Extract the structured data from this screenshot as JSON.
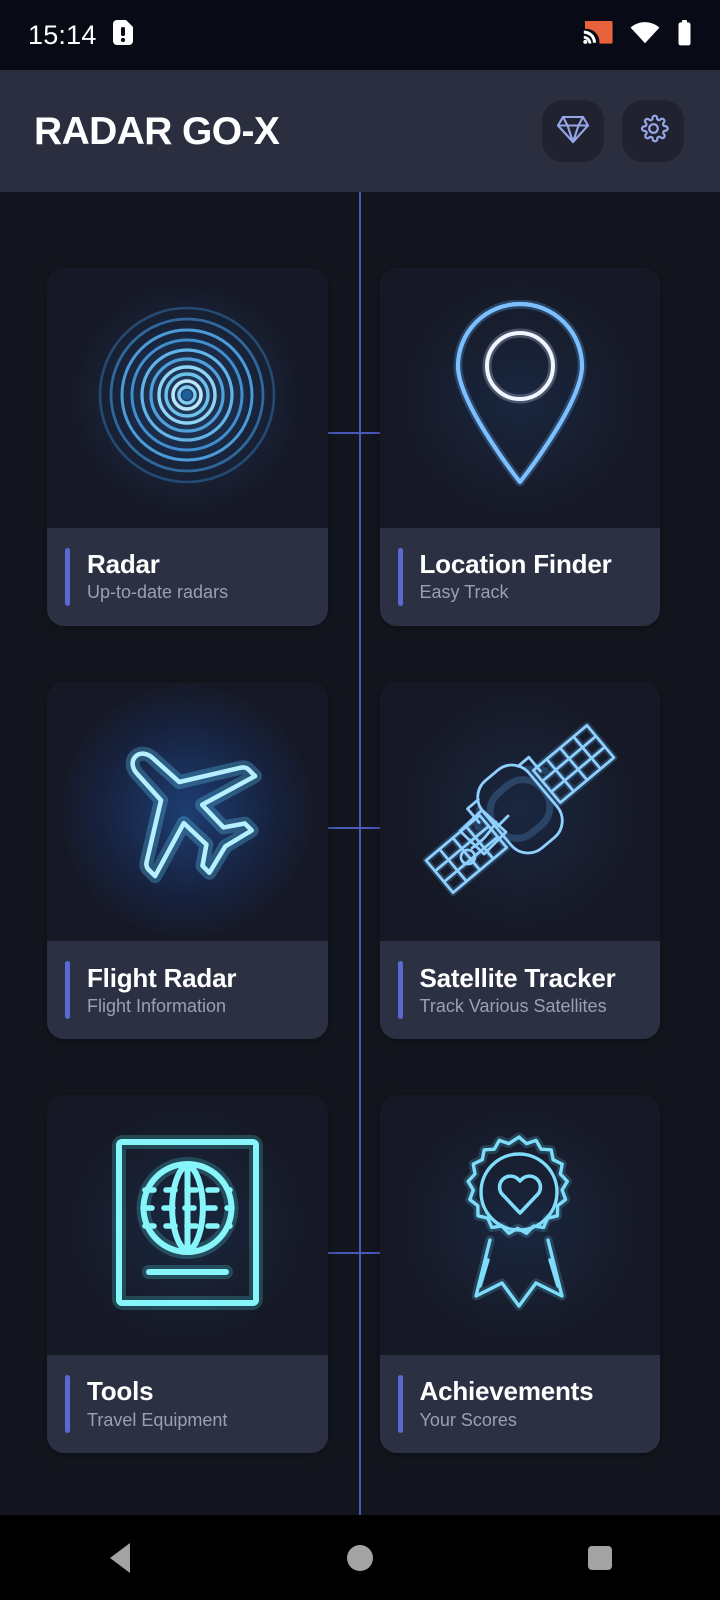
{
  "status_bar": {
    "time": "15:14",
    "sim_icon": "sim-alert-icon",
    "cast_icon": "cast-icon",
    "wifi_icon": "wifi-icon",
    "battery_icon": "battery-icon",
    "cast_color": "#e8623c",
    "background": "#080b15"
  },
  "app_bar": {
    "title": "RADAR GO-X",
    "background": "#2b2e3f",
    "actions": [
      {
        "name": "premium-button",
        "icon": "diamond-icon",
        "color": "#97a6e8"
      },
      {
        "name": "settings-button",
        "icon": "gear-icon",
        "color": "#97a6e8"
      }
    ]
  },
  "theme": {
    "page_background": "#14161f",
    "card_background": "#1b1e2a",
    "card_art_background": "#161925",
    "card_footer_background": "#2c3043",
    "accent_bar": "#5a6ad2",
    "crosshair_line": "#4d5cc0",
    "title_color": "#ffffff",
    "subtitle_color": "#9aa0b4"
  },
  "grid": {
    "columns": 2,
    "rows": 3,
    "cards": [
      {
        "id": "radar",
        "title": "Radar",
        "subtitle": "Up-to-date radars",
        "icon": "radar-rings-icon"
      },
      {
        "id": "location-finder",
        "title": "Location Finder",
        "subtitle": "Easy Track",
        "icon": "map-pin-icon"
      },
      {
        "id": "flight-radar",
        "title": "Flight Radar",
        "subtitle": "Flight Information",
        "icon": "airplane-icon"
      },
      {
        "id": "satellite-tracker",
        "title": "Satellite Tracker",
        "subtitle": "Track Various Satellites",
        "icon": "satellite-icon"
      },
      {
        "id": "tools",
        "title": "Tools",
        "subtitle": "Travel Equipment",
        "icon": "passport-globe-icon"
      },
      {
        "id": "achievements",
        "title": "Achievements",
        "subtitle": "Your Scores",
        "icon": "award-ribbon-icon"
      }
    ]
  },
  "navigation_bar": {
    "background": "#000000",
    "buttons": [
      {
        "name": "nav-back-button",
        "icon": "triangle-back-icon"
      },
      {
        "name": "nav-home-button",
        "icon": "circle-home-icon"
      },
      {
        "name": "nav-recents-button",
        "icon": "square-recents-icon"
      }
    ]
  }
}
